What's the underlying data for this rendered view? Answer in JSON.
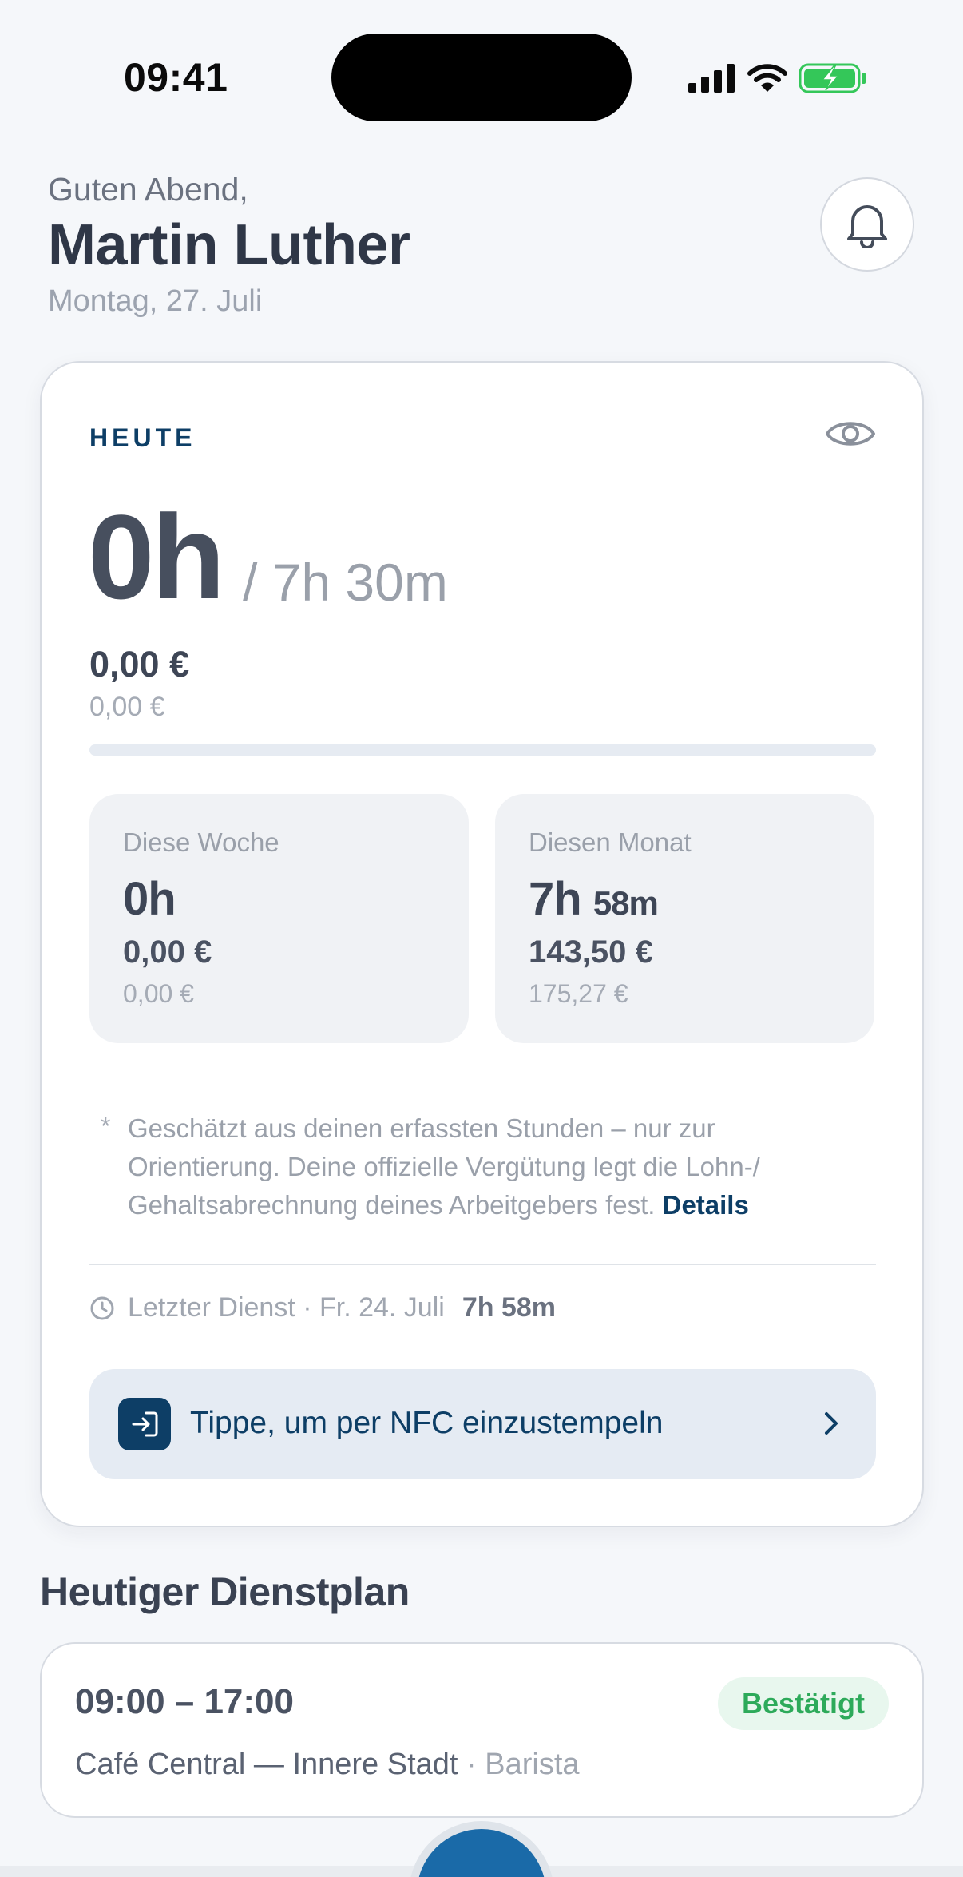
{
  "status_bar": {
    "time": "09:41"
  },
  "header": {
    "greeting": "Guten Abend,",
    "name": "Martin Luther",
    "date": "Montag, 27. Juli"
  },
  "today": {
    "label": "HEUTE",
    "hours": "0h",
    "target": "/ 7h 30m",
    "earnings": "0,00 €",
    "earnings_secondary": "0,00 €",
    "progress_fraction": 0
  },
  "week": {
    "title": "Diese Woche",
    "hours": "0h",
    "earnings": "0,00 €",
    "earnings_secondary": "0,00 €"
  },
  "month": {
    "title": "Diesen Monat",
    "hours": "7h",
    "minutes": "58m",
    "earnings": "143,50 €",
    "earnings_secondary": "175,27 €"
  },
  "note": {
    "star": "*",
    "text": "Geschätzt aus deinen erfassten Stunden – nur zur Orientierung. Deine offizielle Vergütung legt die Lohn-/ Gehaltsabrechnung deines Arbeitgebers fest.",
    "link": "Details"
  },
  "last_shift": {
    "label": "Letzter Dienst · Fr. 24. Juli",
    "duration": "7h 58m"
  },
  "nfc": {
    "label": "Tippe, um per NFC einzustempeln"
  },
  "schedule": {
    "title": "Heutiger Dienstplan",
    "time": "09:00 – 17:00",
    "status": "Bestätigt",
    "place": "Café Central — Innere Stadt",
    "role": "· Barista"
  },
  "icons": {
    "notification": "bell-icon",
    "visibility": "eye-icon",
    "clock": "clock-icon",
    "nfc": "login-arrow-icon",
    "chevron": "chevron-right-icon"
  },
  "colors": {
    "primary": "#0d3e66",
    "success": "#2daa5a",
    "success_bg": "#e8f7ee",
    "battery": "#34c759"
  }
}
